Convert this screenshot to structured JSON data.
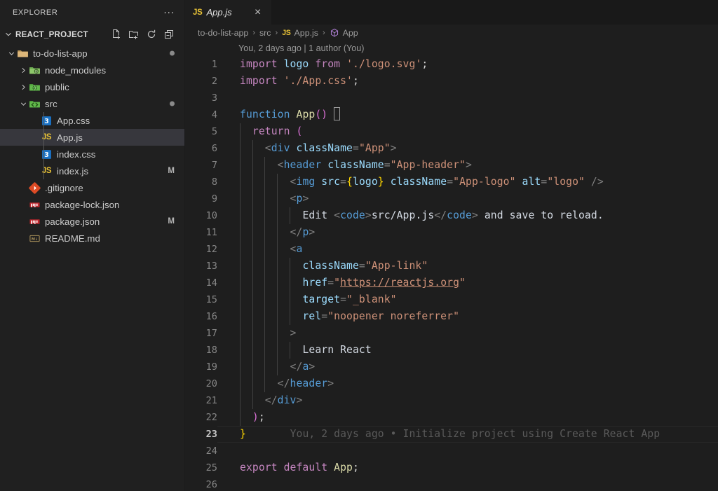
{
  "sidebar": {
    "title": "EXPLORER",
    "more_actions_label": "...",
    "root": {
      "label": "REACT_PROJECT",
      "expanded": true,
      "actions": [
        {
          "name": "new-file-icon",
          "label": "New File"
        },
        {
          "name": "new-folder-icon",
          "label": "New Folder"
        },
        {
          "name": "refresh-icon",
          "label": "Refresh Explorer"
        },
        {
          "name": "collapse-all-icon",
          "label": "Collapse Folders in Explorer"
        }
      ]
    },
    "tree": [
      {
        "label": "to-do-list-app",
        "type": "folder",
        "icon": "folder-open-icon",
        "depth": 0,
        "expanded": true,
        "badge": "dot",
        "selected": false
      },
      {
        "label": "node_modules",
        "type": "folder",
        "icon": "folder-node-icon",
        "depth": 1,
        "expanded": false,
        "badge": "",
        "selected": false
      },
      {
        "label": "public",
        "type": "folder",
        "icon": "folder-public-icon",
        "depth": 1,
        "expanded": false,
        "badge": "",
        "selected": false
      },
      {
        "label": "src",
        "type": "folder",
        "icon": "folder-src-icon",
        "depth": 1,
        "expanded": true,
        "badge": "dot",
        "selected": false
      },
      {
        "label": "App.css",
        "type": "file",
        "icon": "css-file-icon",
        "depth": 2,
        "expanded": null,
        "badge": "",
        "selected": false
      },
      {
        "label": "App.js",
        "type": "file",
        "icon": "js-file-icon",
        "depth": 2,
        "expanded": null,
        "badge": "",
        "selected": true
      },
      {
        "label": "index.css",
        "type": "file",
        "icon": "css-file-icon",
        "depth": 2,
        "expanded": null,
        "badge": "",
        "selected": false
      },
      {
        "label": "index.js",
        "type": "file",
        "icon": "js-file-icon",
        "depth": 2,
        "expanded": null,
        "badge": "M",
        "selected": false
      },
      {
        "label": ".gitignore",
        "type": "file",
        "icon": "git-file-icon",
        "depth": 1,
        "expanded": null,
        "badge": "",
        "selected": false
      },
      {
        "label": "package-lock.json",
        "type": "file",
        "icon": "npm-file-icon",
        "depth": 1,
        "expanded": null,
        "badge": "",
        "selected": false
      },
      {
        "label": "package.json",
        "type": "file",
        "icon": "npm-file-icon",
        "depth": 1,
        "expanded": null,
        "badge": "M",
        "selected": false
      },
      {
        "label": "README.md",
        "type": "file",
        "icon": "markdown-file-icon",
        "depth": 1,
        "expanded": null,
        "badge": "",
        "selected": false
      }
    ]
  },
  "editor": {
    "tabs": [
      {
        "label": "App.js",
        "icon": "js-file-icon",
        "italic": true,
        "active": true,
        "close_label": "×"
      }
    ],
    "breadcrumb": [
      {
        "label": "to-do-list-app",
        "icon": ""
      },
      {
        "label": "src",
        "icon": ""
      },
      {
        "label": "App.js",
        "icon": "js-file-icon"
      },
      {
        "label": "App",
        "icon": "symbol-class-icon"
      }
    ],
    "breadcrumb_separator": "›",
    "blame_header": "You, 2 days ago | 1 author (You)",
    "inline_blame": {
      "line": 23,
      "text": "You, 2 days ago • Initialize project using Create React App"
    },
    "cursor_line": 23,
    "line_numbers": [
      1,
      2,
      3,
      4,
      5,
      6,
      7,
      8,
      9,
      10,
      11,
      12,
      13,
      14,
      15,
      16,
      17,
      18,
      19,
      20,
      21,
      22,
      23,
      24,
      25,
      26
    ],
    "lines": [
      "import logo from './logo.svg';",
      "import './App.css';",
      "",
      "function App() {",
      "  return (",
      "    <div className=\"App\">",
      "      <header className=\"App-header\">",
      "        <img src={logo} className=\"App-logo\" alt=\"logo\" />",
      "        <p>",
      "          Edit <code>src/App.js</code> and save to reload.",
      "        </p>",
      "        <a",
      "          className=\"App-link\"",
      "          href=\"https://reactjs.org\"",
      "          target=\"_blank\"",
      "          rel=\"noopener noreferrer\"",
      "        >",
      "          Learn React",
      "        </a>",
      "      </header>",
      "    </div>",
      "  );",
      "}",
      "",
      "export default App;",
      ""
    ]
  },
  "colors": {
    "sidebar_bg": "#202020",
    "editor_bg": "#1e1e1e",
    "tabbar_bg": "#191919",
    "selection_bg": "#37373d",
    "keyword": "#c586c0",
    "control": "#569cd6",
    "variable": "#9cdcfe",
    "string": "#ce9178",
    "function": "#dcdcaa",
    "punctuation": "#808080",
    "brace_yellow": "#ffd700",
    "paren_magenta": "#da70d6",
    "linenumber": "#868686",
    "blame_text": "#5a5a5a",
    "js_badge": "#e8c236"
  }
}
